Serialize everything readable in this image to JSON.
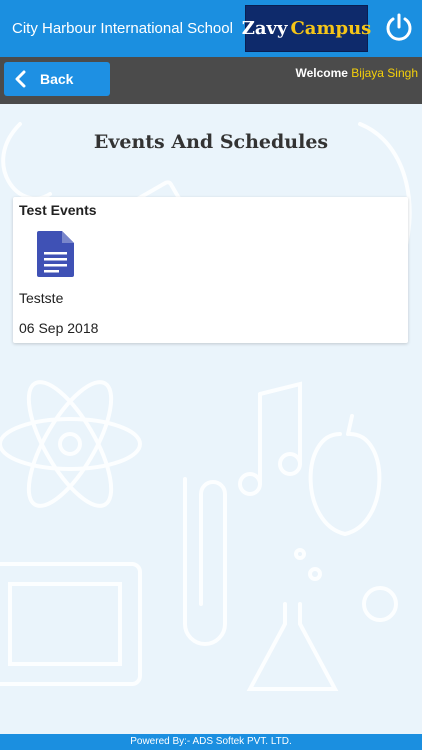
{
  "header": {
    "school_name": "City Harbour International School",
    "brand_word1": "Zavy",
    "brand_word2": "Campus"
  },
  "subbar": {
    "back_label": "Back",
    "welcome_label": "Welcome",
    "user_name": "Bijaya Singh"
  },
  "page": {
    "title": "Events And Schedules"
  },
  "event_card": {
    "category": "Test Events",
    "name": "Testste",
    "date": "06 Sep 2018",
    "icon": "document-icon"
  },
  "footer": {
    "text": "Powered By:- ADS Softek PVT. LTD."
  },
  "colors": {
    "header_blue": "#1b8fe0",
    "subbar_gray": "#4b4b4b",
    "username_yellow": "#f5d10a",
    "doc_icon_blue": "#3f51b5"
  }
}
